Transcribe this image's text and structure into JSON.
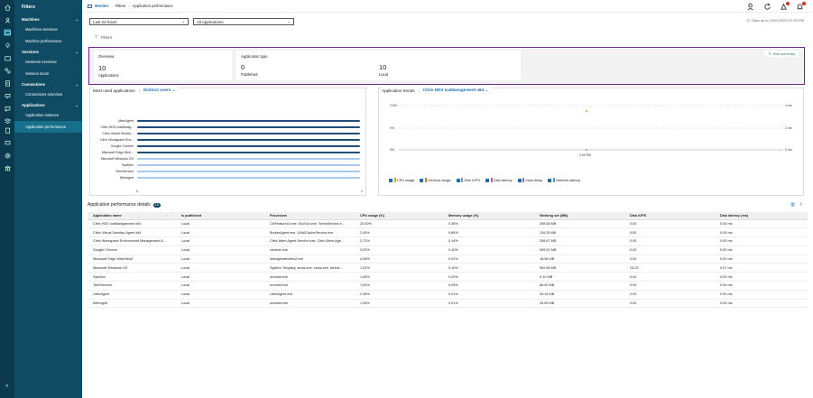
{
  "sidebar": {
    "header": "Filters",
    "sections": [
      {
        "label": "Machines",
        "items": [
          "Machines overview",
          "Machine performance"
        ]
      },
      {
        "label": "Sessions",
        "items": [
          "Sessions overview",
          "Session score"
        ]
      },
      {
        "label": "Connections",
        "items": [
          "Connections overview"
        ]
      },
      {
        "label": "Applications",
        "items": [
          "Application instance",
          "Application performance"
        ]
      }
    ]
  },
  "breadcrumb": {
    "root": "Monitor",
    "mid": "Filters",
    "current": "Application performance"
  },
  "filters": {
    "time": "Last 24 hours",
    "apps": "All Applications",
    "filter_label": "Filters",
    "data_up": "Data up to 10/31/2025 07:43 PM"
  },
  "overview": {
    "title": "Overview",
    "total": "10",
    "total_label": "Applications",
    "type_title": "Application type",
    "published": "0",
    "published_label": "Published",
    "local": "10",
    "local_label": "Local",
    "hide_label": "Hide summary"
  },
  "most_used": {
    "title": "Most used applications",
    "dropdown": "Distinct users",
    "apps": [
      "UberAgent",
      "Citrix HDX IcaManag...",
      "Citrix Virtual Deskto...",
      "Citrix Workspace Env...",
      "Google Chrome",
      "Microsoft Edge Web...",
      "Microsoft Windows OS",
      "SysMon",
      "TermService",
      "Winmgmt"
    ],
    "x_ticks": [
      "0",
      "1"
    ]
  },
  "trends": {
    "title": "Application trends",
    "dropdown": "Citrix HDX IcaManagement x64",
    "y_left": [
      "2.5%",
      "0%",
      "0%"
    ],
    "y_right": [
      "4 ms",
      "2 ms",
      "0 ms"
    ],
    "x_label": "2:00 PM",
    "legend": [
      "CPU usage",
      "Memory usage",
      "Disk IOPS",
      "Disk latency",
      "Input delay",
      "Network latency"
    ],
    "legend_colors": [
      "#d9a21b",
      "#d97a2b",
      "#7e8fd1",
      "#b55fbf",
      "#9a6fcf",
      "#4aa3b0"
    ]
  },
  "details": {
    "title": "Application performance details",
    "count": "10",
    "columns": [
      "Application name",
      "Is published",
      "Processes",
      "CPU usage (%)",
      "Memory usage (%)",
      "Working set (MB)",
      "Disk IOPS",
      "Disk latency (ms)"
    ],
    "rows": [
      [
        "Citrix HDX IcaManagement x64",
        "Local",
        "CtxFeatureUI.exe, EncSvc.exe, SemsService.e...",
        "20.00%",
        "0.36%",
        "298.68 MB",
        "0.00",
        "0.00 ms"
      ],
      [
        "Citrix Virtual Desktop Agent x64",
        "Local",
        "BrokerAgent.exe, UNIACacheService.exe",
        "2.45%",
        "0.86%",
        "116.25 MB",
        "0.00",
        "0.00 ms"
      ],
      [
        "Citrix Workspace Environment Management A...",
        "Local",
        "Citrix.Wem.Agent.Service.exe, Citrix.Wem.Age...",
        "2.72%",
        "0.14%",
        "258.67 MB",
        "0.00",
        "0.00 ms"
      ],
      [
        "Google Chrome",
        "Local",
        "chrome.exe",
        "3.02%",
        "0.10%",
        "505.92 MB",
        "0.00",
        "0.00 ms"
      ],
      [
        "Microsoft Edge WebView2",
        "Local",
        "msedgewebview2.exe",
        "4.08%",
        "0.02%",
        "18.58 MB",
        "0.00",
        "0.00 ms"
      ],
      [
        "Microsoft Windows OS",
        "Local",
        "System, Registry, smss.exe, csrss.exe, wininit....",
        "1.02%",
        "0.10%",
        "562.58 MB",
        "23.23",
        "0.07 ms"
      ],
      [
        "SysMon",
        "Local",
        "svchost.exe",
        "1.06%",
        "0.00%",
        "9.10 MB",
        "0.00",
        "0.00 ms"
      ],
      [
        "TermService",
        "Local",
        "svchost.exe",
        "1.52%",
        "0.05%",
        "66.90 MB",
        "0.00",
        "0.00 ms"
      ],
      [
        "UberAgent",
        "Local",
        "UberAgent.exe",
        "2.45%",
        "0.01%",
        "33.15 MB",
        "0.00",
        "0.00 ms"
      ],
      [
        "Winmgmt",
        "Local",
        "svchost.exe",
        "1.35%",
        "0.01%",
        "25.95 MB",
        "0.00",
        "0.00 ms"
      ]
    ]
  },
  "colors": {
    "sidebar": "#0f4c64",
    "rail": "#0b3a4f",
    "accent": "#1a6fb5",
    "highlight_border": "#6a2b8e",
    "bar_dark": "#1f4e79",
    "bar_light": "#a9c8ec"
  }
}
